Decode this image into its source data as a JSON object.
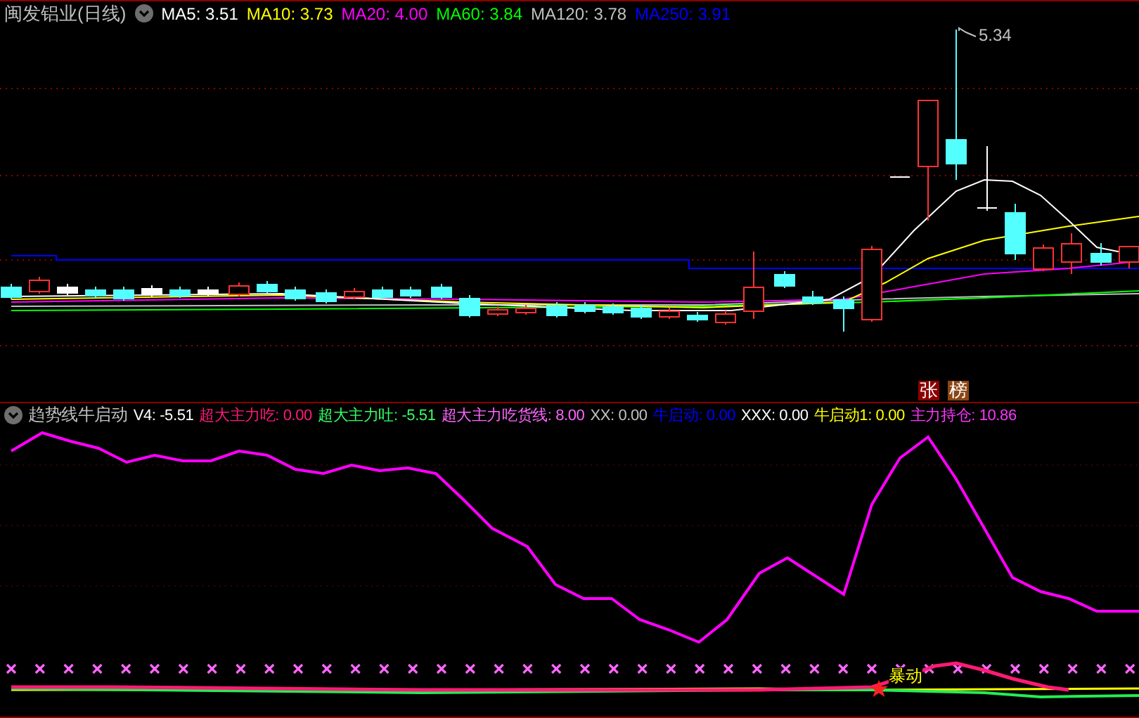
{
  "title": "闽发铝业(日线)",
  "ma_legend": [
    {
      "label": "MA5: 3.51",
      "color": "#ffffff"
    },
    {
      "label": "MA10: 3.73",
      "color": "#ffff00"
    },
    {
      "label": "MA20: 4.00",
      "color": "#ff00ff"
    },
    {
      "label": "MA60: 3.84",
      "color": "#00ff00"
    },
    {
      "label": "MA120: 3.78",
      "color": "#c0c0c0"
    },
    {
      "label": "MA250: 3.91",
      "color": "#0000ff"
    }
  ],
  "price_chart": {
    "high_label": "5.34",
    "badges": [
      {
        "text": "张",
        "color": "#8b0000"
      },
      {
        "text": "榜",
        "color": "#8b4513"
      }
    ]
  },
  "indicator": {
    "title": "趋势线牛启动",
    "legend": [
      {
        "label": "V4: -5.51",
        "color": "#ffffff"
      },
      {
        "label": "超大主力吃: 0.00",
        "color": "#ff1a75"
      },
      {
        "label": "超大主力吐: -5.51",
        "color": "#33ff66"
      },
      {
        "label": "超大主力吃货线: 8.00",
        "color": "#ff66ff"
      },
      {
        "label": "XX: 0.00",
        "color": "#c0c0c0"
      },
      {
        "label": "牛启动: 0.00",
        "color": "#0000ff"
      },
      {
        "label": "XXX: 0.00",
        "color": "#ffffff"
      },
      {
        "label": "牛启动1: 0.00",
        "color": "#ffff00"
      },
      {
        "label": "主力持仓: 10.86",
        "color": "#ff33ff"
      }
    ],
    "signal_text": "暴动"
  }
}
